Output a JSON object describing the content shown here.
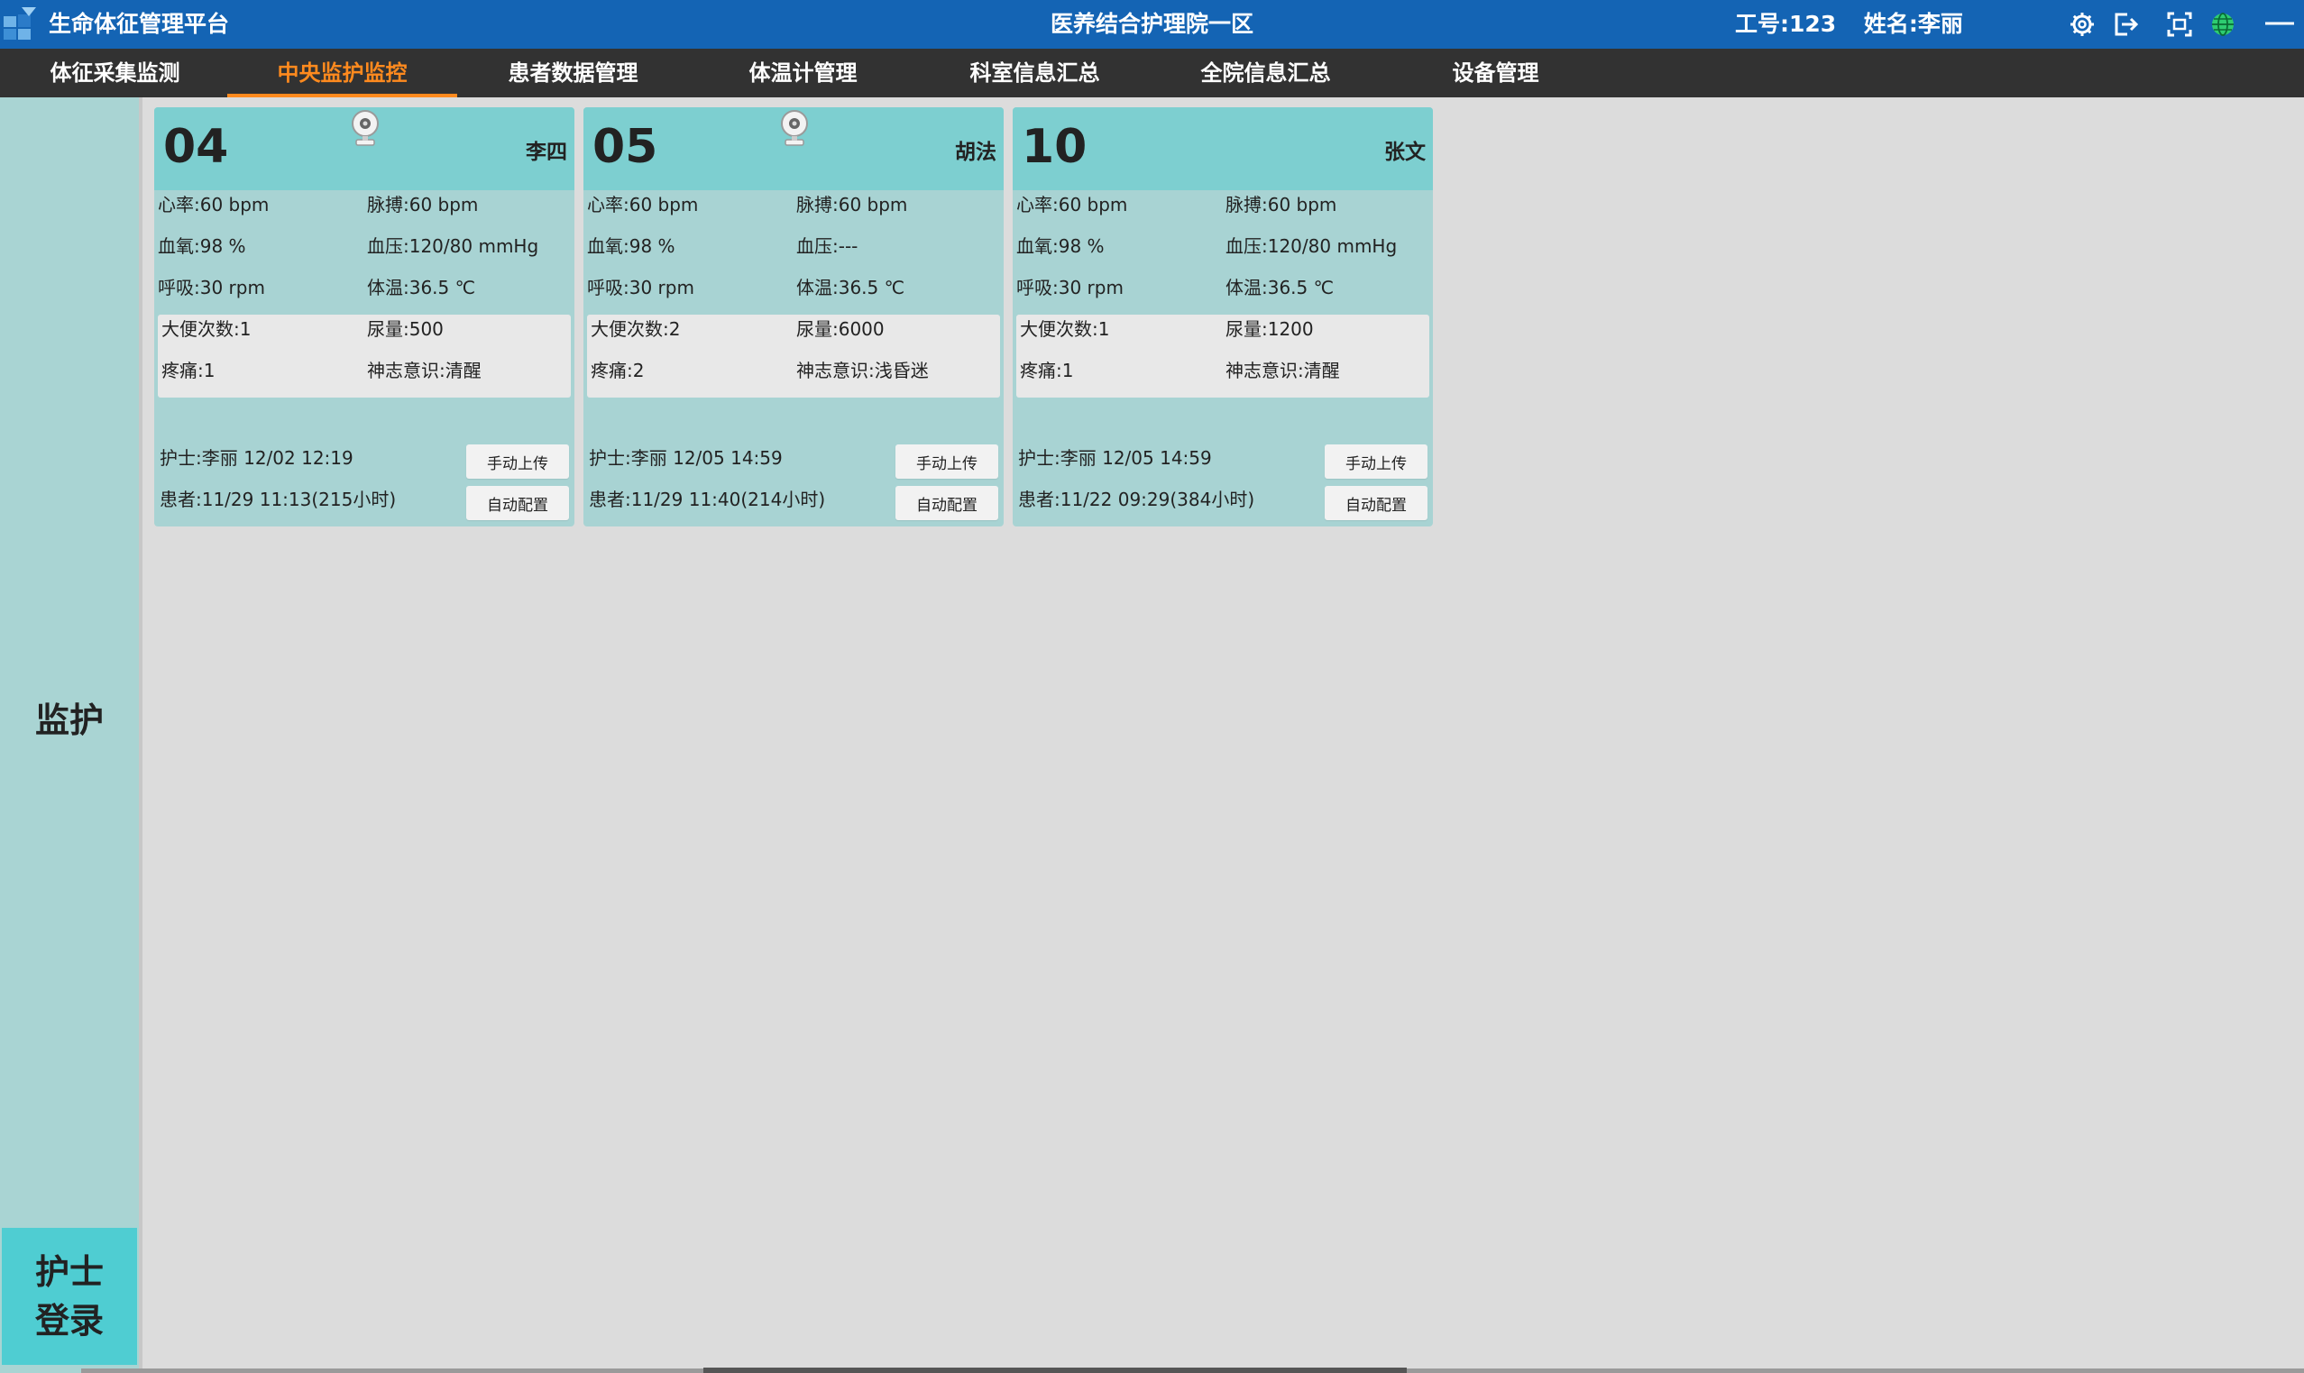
{
  "titlebar": {
    "app_title": "生命体征管理平台",
    "center_title": "医养结合护理院一区",
    "staff_id": "工号:123",
    "staff_name": "姓名:李丽",
    "bg_color": "#1464b4"
  },
  "nav": {
    "items": [
      {
        "label": "体征采集监测"
      },
      {
        "label": "中央监护监控"
      },
      {
        "label": "患者数据管理"
      },
      {
        "label": "体温计管理"
      },
      {
        "label": "科室信息汇总"
      },
      {
        "label": "全院信息汇总"
      },
      {
        "label": "设备管理"
      }
    ],
    "active_index": 1,
    "active_color": "#ff8a1e"
  },
  "sidebar": {
    "monitor_label": "监护",
    "login_label_1": "护士",
    "login_label_2": "登录"
  },
  "cards": [
    {
      "bed": "04",
      "patient": "李四",
      "has_camera": true,
      "heart_rate": "心率:60 bpm",
      "pulse": "脉搏:60 bpm",
      "spo2": "血氧:98 %",
      "bp": "血压:120/80 mmHg",
      "resp": "呼吸:30 rpm",
      "temp": "体温:36.5 ℃",
      "stool": "大便次数:1",
      "urine": "尿量:500",
      "pain": "疼痛:1",
      "consciousness": "神志意识:清醒",
      "nurse_line": "护士:李丽 12/02 12:19",
      "patient_line": "患者:11/29 11:13(215小时)",
      "btn_upload": "手动上传",
      "btn_config": "自动配置"
    },
    {
      "bed": "05",
      "patient": "胡法",
      "has_camera": true,
      "heart_rate": "心率:60 bpm",
      "pulse": "脉搏:60 bpm",
      "spo2": "血氧:98 %",
      "bp": "血压:---",
      "resp": "呼吸:30 rpm",
      "temp": "体温:36.5 ℃",
      "stool": "大便次数:2",
      "urine": "尿量:6000",
      "pain": "疼痛:2",
      "consciousness": "神志意识:浅昏迷",
      "nurse_line": "护士:李丽 12/05 14:59",
      "patient_line": "患者:11/29 11:40(214小时)",
      "btn_upload": "手动上传",
      "btn_config": "自动配置"
    },
    {
      "bed": "10",
      "patient": "张文",
      "has_camera": false,
      "heart_rate": "心率:60 bpm",
      "pulse": "脉搏:60 bpm",
      "spo2": "血氧:98 %",
      "bp": "血压:120/80 mmHg",
      "resp": "呼吸:30 rpm",
      "temp": "体温:36.5 ℃",
      "stool": "大便次数:1",
      "urine": "尿量:1200",
      "pain": "疼痛:1",
      "consciousness": "神志意识:清醒",
      "nurse_line": "护士:李丽 12/05 14:59",
      "patient_line": "患者:11/22 09:29(384小时)",
      "btn_upload": "手动上传",
      "btn_config": "自动配置"
    }
  ],
  "icons": {
    "settings": "gear-icon",
    "logout": "logout-icon",
    "screenshot": "screenshot-icon",
    "language": "globe-icon",
    "minimize": "minimize-icon",
    "camera": "camera-icon"
  }
}
